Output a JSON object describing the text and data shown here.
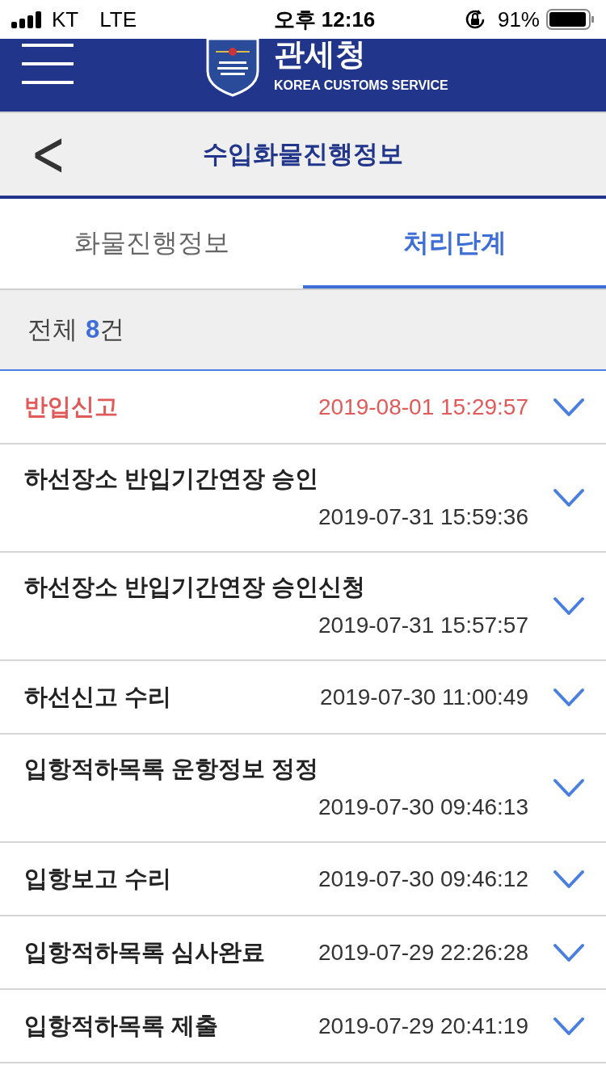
{
  "status_bar": {
    "carrier": "KT",
    "network": "LTE",
    "time": "오후 12:16",
    "battery": "91%"
  },
  "header": {
    "title": "관세청",
    "subtitle": "KOREA CUSTOMS SERVICE"
  },
  "title_bar": {
    "back": "<",
    "title": "수입화물진행정보"
  },
  "tabs": [
    {
      "label": "화물진행정보",
      "selected": false
    },
    {
      "label": "처리단계",
      "selected": true
    }
  ],
  "summary": {
    "label": "전체",
    "count": "8",
    "unit": "건"
  },
  "steps": [
    {
      "name": "반입신고",
      "time": "2019-08-01 15:29:57",
      "kind": "inline",
      "highlighted": true
    },
    {
      "name": "하선장소 반입기간연장 승인",
      "time": "2019-07-31 15:59:36",
      "kind": "stacked",
      "highlighted": false
    },
    {
      "name": "하선장소 반입기간연장 승인신청",
      "time": "2019-07-31 15:57:57",
      "kind": "stacked",
      "highlighted": false
    },
    {
      "name": "하선신고 수리",
      "time": "2019-07-30 11:00:49",
      "kind": "inline",
      "highlighted": false
    },
    {
      "name": "입항적하목록 운항정보 정정",
      "time": "2019-07-30 09:46:13",
      "kind": "stacked",
      "highlighted": false
    },
    {
      "name": "입항보고 수리",
      "time": "2019-07-30 09:46:12",
      "kind": "inline",
      "highlighted": false
    },
    {
      "name": "입항적하목록 심사완료",
      "time": "2019-07-29 22:26:28",
      "kind": "inline",
      "highlighted": false
    },
    {
      "name": "입항적하목록 제출",
      "time": "2019-07-29 20:41:19",
      "kind": "inline",
      "highlighted": false
    }
  ]
}
